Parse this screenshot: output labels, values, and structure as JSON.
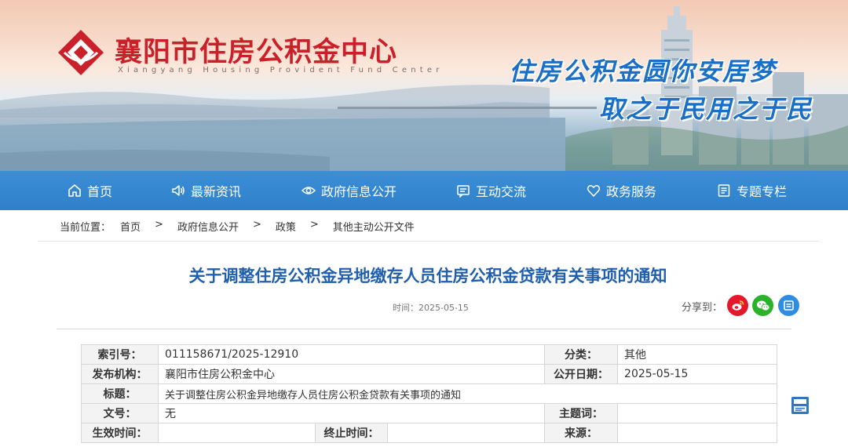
{
  "site": {
    "title": "襄阳市住房公积金中心",
    "subtitle": "Xiangyang Housing Provident Fund Center",
    "slogan_line1": "住房公积金圆你安居梦",
    "slogan_line2": "取之于民用之于民"
  },
  "nav": {
    "items": [
      {
        "label": "首页",
        "icon": "home-icon"
      },
      {
        "label": "最新资讯",
        "icon": "speaker-icon"
      },
      {
        "label": "政府信息公开",
        "icon": "eye-icon"
      },
      {
        "label": "互动交流",
        "icon": "message-icon"
      },
      {
        "label": "政务服务",
        "icon": "heart-icon"
      },
      {
        "label": "专题专栏",
        "icon": "document-icon"
      }
    ]
  },
  "breadcrumb": {
    "prefix": "当前位置：",
    "items": [
      "首页",
      "政府信息公开",
      "政策",
      "其他主动公开文件"
    ],
    "separator": ">"
  },
  "article": {
    "title": "关于调整住房公积金异地缴存人员住房公积金贷款有关事项的通知",
    "time": "时间：2025-05-15",
    "share_label": "分享到："
  },
  "share": {
    "buttons": [
      "weibo-icon",
      "wechat-icon",
      "qzone-icon"
    ],
    "colors": {
      "weibo": "#e6162d",
      "wechat": "#2bb22b",
      "qzone": "#2e8de2"
    }
  },
  "info": {
    "index_label": "索引号：",
    "index_value": "011158671/2025-12910",
    "category_label": "分类：",
    "category_value": "其他",
    "publisher_label": "发布机构：",
    "publisher_value": "襄阳市住房公积金中心",
    "pubdate_label": "公开日期：",
    "pubdate_value": "2025-05-15",
    "title_label": "标题：",
    "title_value": "关于调整住房公积金异地缴存人员住房公积金贷款有关事项的通知",
    "docno_label": "文号：",
    "docno_value": "无",
    "subject_label": "主题词：",
    "subject_value": "",
    "effective_label": "生效时间：",
    "effective_value": "",
    "expire_label": "终止时间：",
    "expire_value": "",
    "source_label": "来源：",
    "source_value": ""
  },
  "colors": {
    "brand_red": "#c9202a",
    "nav_blue": "#2f80c9",
    "title_blue": "#1f5fae",
    "slogan_blue": "#1a6fc7"
  }
}
